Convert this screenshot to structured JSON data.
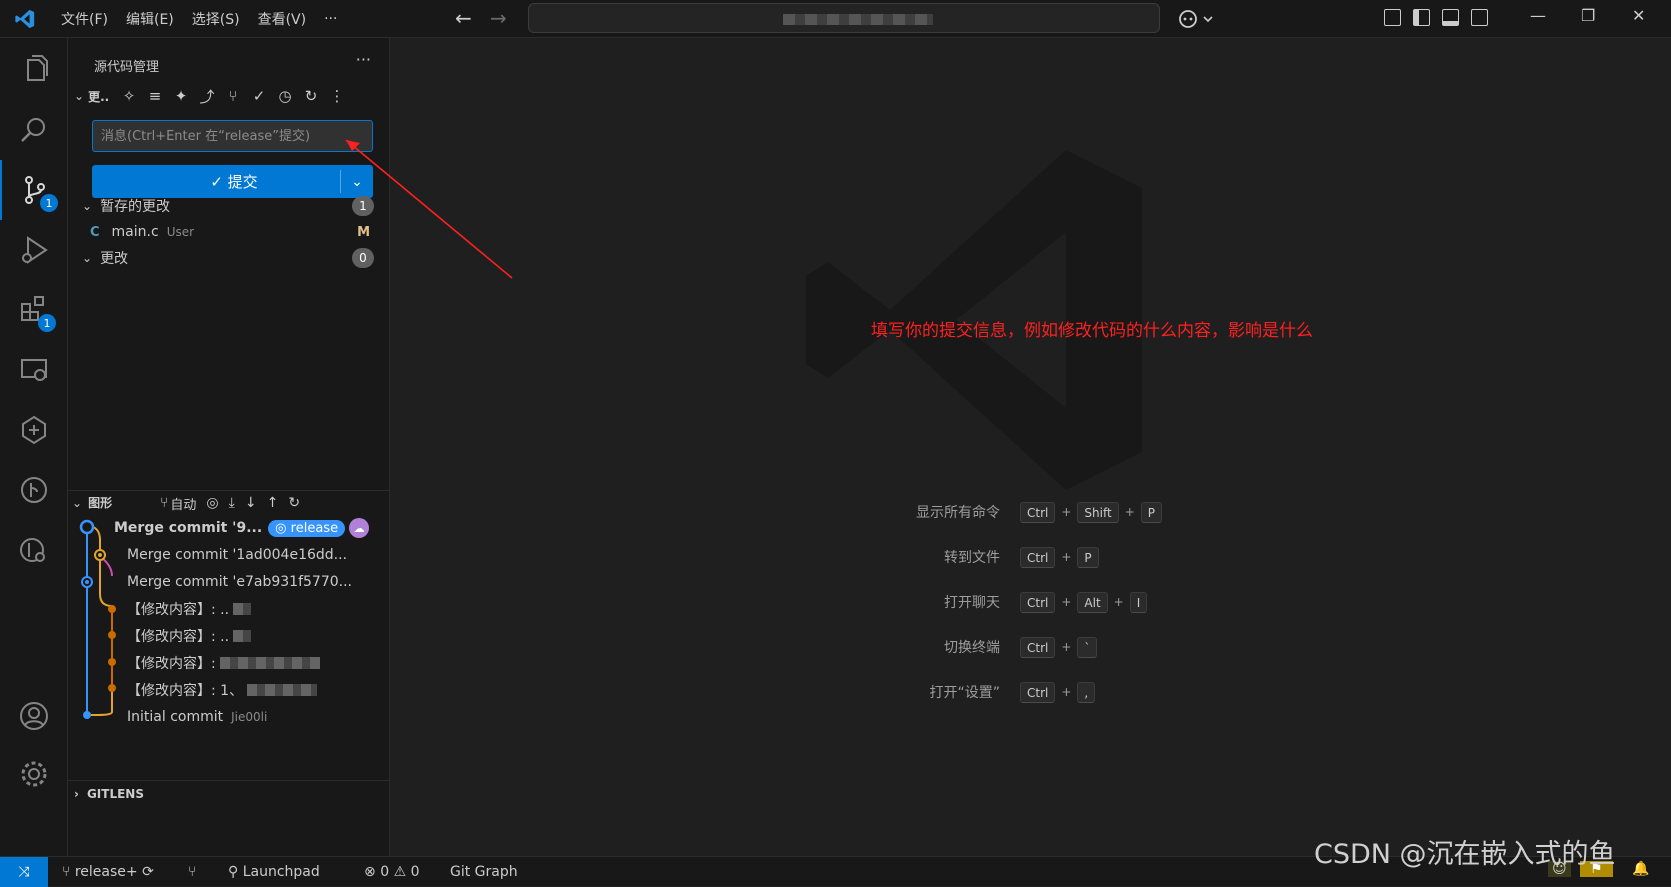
{
  "menu": {
    "items": [
      "文件(F)",
      "编辑(E)",
      "选择(S)",
      "查看(V)",
      "···"
    ]
  },
  "activity": {
    "scm_badge": "1",
    "extensions_badge": "1"
  },
  "scm": {
    "title": "源代码管理",
    "more": "···",
    "repo_label": "更..",
    "message_placeholder": "消息(Ctrl+Enter 在“release”提交)",
    "commit_label": "✓ 提交",
    "staged_label": "暂存的更改",
    "staged_count": "1",
    "file_name": "main.c",
    "file_path": "User",
    "file_status": "M",
    "file_lang": "C",
    "changes_label": "更改",
    "changes_count": "0"
  },
  "graph": {
    "title": "图形",
    "auto_label": "自动",
    "commits": [
      {
        "text": "Merge commit '9...",
        "bold": true
      },
      {
        "text": "Merge commit '1ad004e16dd...",
        "bold": false
      },
      {
        "text": "Merge commit 'e7ab931f5770...",
        "bold": false
      },
      {
        "text": "【修改内容】: ..",
        "bold": false
      },
      {
        "text": "【修改内容】: ..",
        "bold": false
      },
      {
        "text": "【修改内容】:",
        "bold": false
      },
      {
        "text": "【修改内容】: 1、",
        "bold": false
      },
      {
        "text": "Initial commit",
        "bold": false
      }
    ],
    "branch_badge": "release",
    "author": "Jie00li"
  },
  "gitlens": {
    "label": "GITLENS"
  },
  "shortcuts": [
    {
      "name": "显示所有命令",
      "keys": [
        "Ctrl",
        "Shift",
        "P"
      ]
    },
    {
      "name": "转到文件",
      "keys": [
        "Ctrl",
        "P"
      ]
    },
    {
      "name": "打开聊天",
      "keys": [
        "Ctrl",
        "Alt",
        "I"
      ]
    },
    {
      "name": "切换终端",
      "keys": [
        "Ctrl",
        "`"
      ]
    },
    {
      "name": "打开“设置”",
      "keys": [
        "Ctrl",
        ","
      ]
    }
  ],
  "annotation": "填写你的提交信息，例如修改代码的什么内容，影响是什么",
  "status": {
    "branch": "release+",
    "launchpad": "Launchpad",
    "errors": "0",
    "warnings": "0",
    "git_graph": "Git Graph"
  },
  "watermark_text": "CSDN @沉在嵌入式的鱼",
  "colors": {
    "accent": "#0078d4",
    "annotation": "#ff2020",
    "graph_blue": "#3794ff",
    "graph_orange": "#c96b00",
    "graph_yellow": "#e2a42c",
    "graph_pink": "#d14fa4"
  }
}
